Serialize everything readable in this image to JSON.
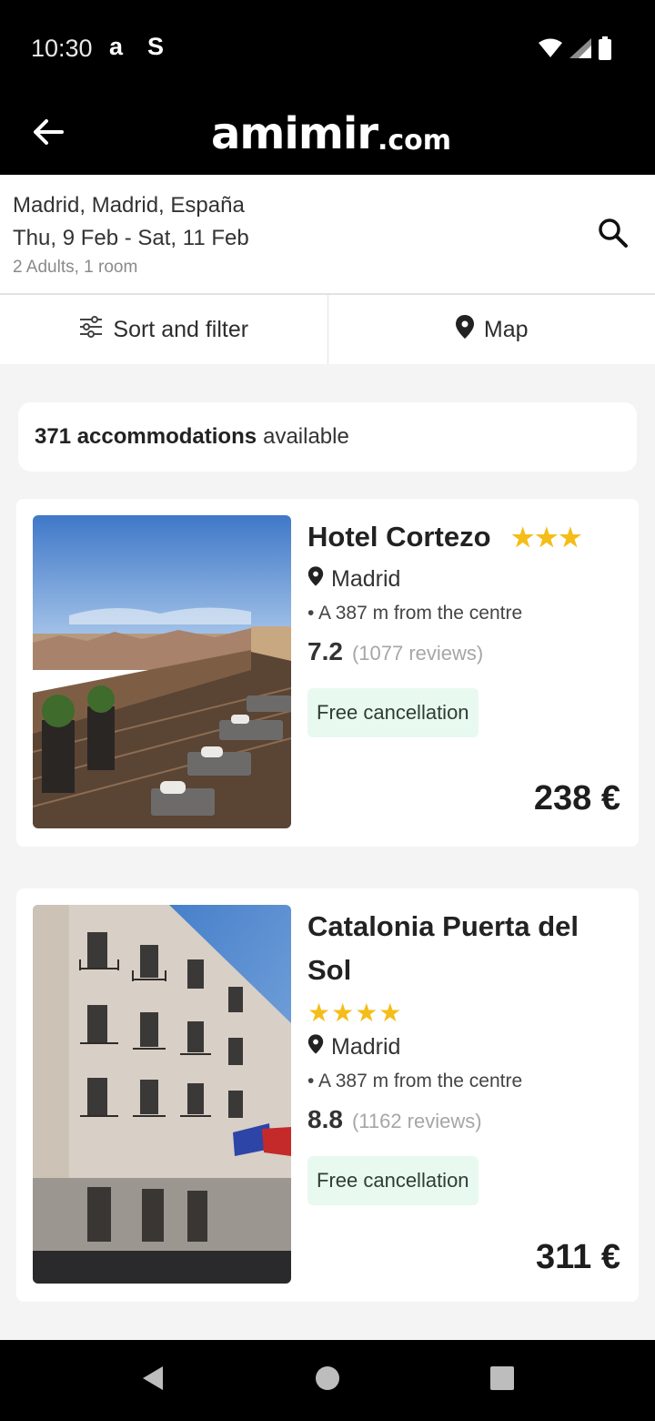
{
  "status_bar": {
    "time": "10:30",
    "app_glyph_1": "a",
    "app_glyph_2": "S",
    "icons": [
      "wifi-icon",
      "signal-icon",
      "battery-icon"
    ]
  },
  "app_bar": {
    "back_icon": "arrow-left-icon",
    "logo_main": "amimir",
    "logo_domain": ".com"
  },
  "search": {
    "location": "Madrid, Madrid, España",
    "dates": "Thu, 9 Feb - Sat, 11 Feb",
    "guests": "2 Adults, 1 room",
    "search_icon": "search-icon"
  },
  "filters": {
    "sort_label": "Sort and filter",
    "map_label": "Map"
  },
  "results": {
    "count_bold": "371 accommodations",
    "count_suffix": "available"
  },
  "hotels": [
    {
      "name": "Hotel Cortezo",
      "stars": 3,
      "stars_text": "★★★",
      "city": "Madrid",
      "distance": "• A 387 m from the centre",
      "rating": "7.2",
      "reviews": "(1077 reviews)",
      "badge": "Free cancellation",
      "price": "238 €"
    },
    {
      "name": "Catalonia Puerta del Sol",
      "stars": 4,
      "stars_text": "★★★★",
      "city": "Madrid",
      "distance": "• A 387 m from the centre",
      "rating": "8.8",
      "reviews": "(1162 reviews)",
      "badge": "Free cancellation",
      "price": "311 €"
    }
  ],
  "colors": {
    "star": "#f5bd1a",
    "badge_bg": "#e8f9ef",
    "bar_bg": "#000000",
    "page_bg": "#f4f4f5"
  }
}
